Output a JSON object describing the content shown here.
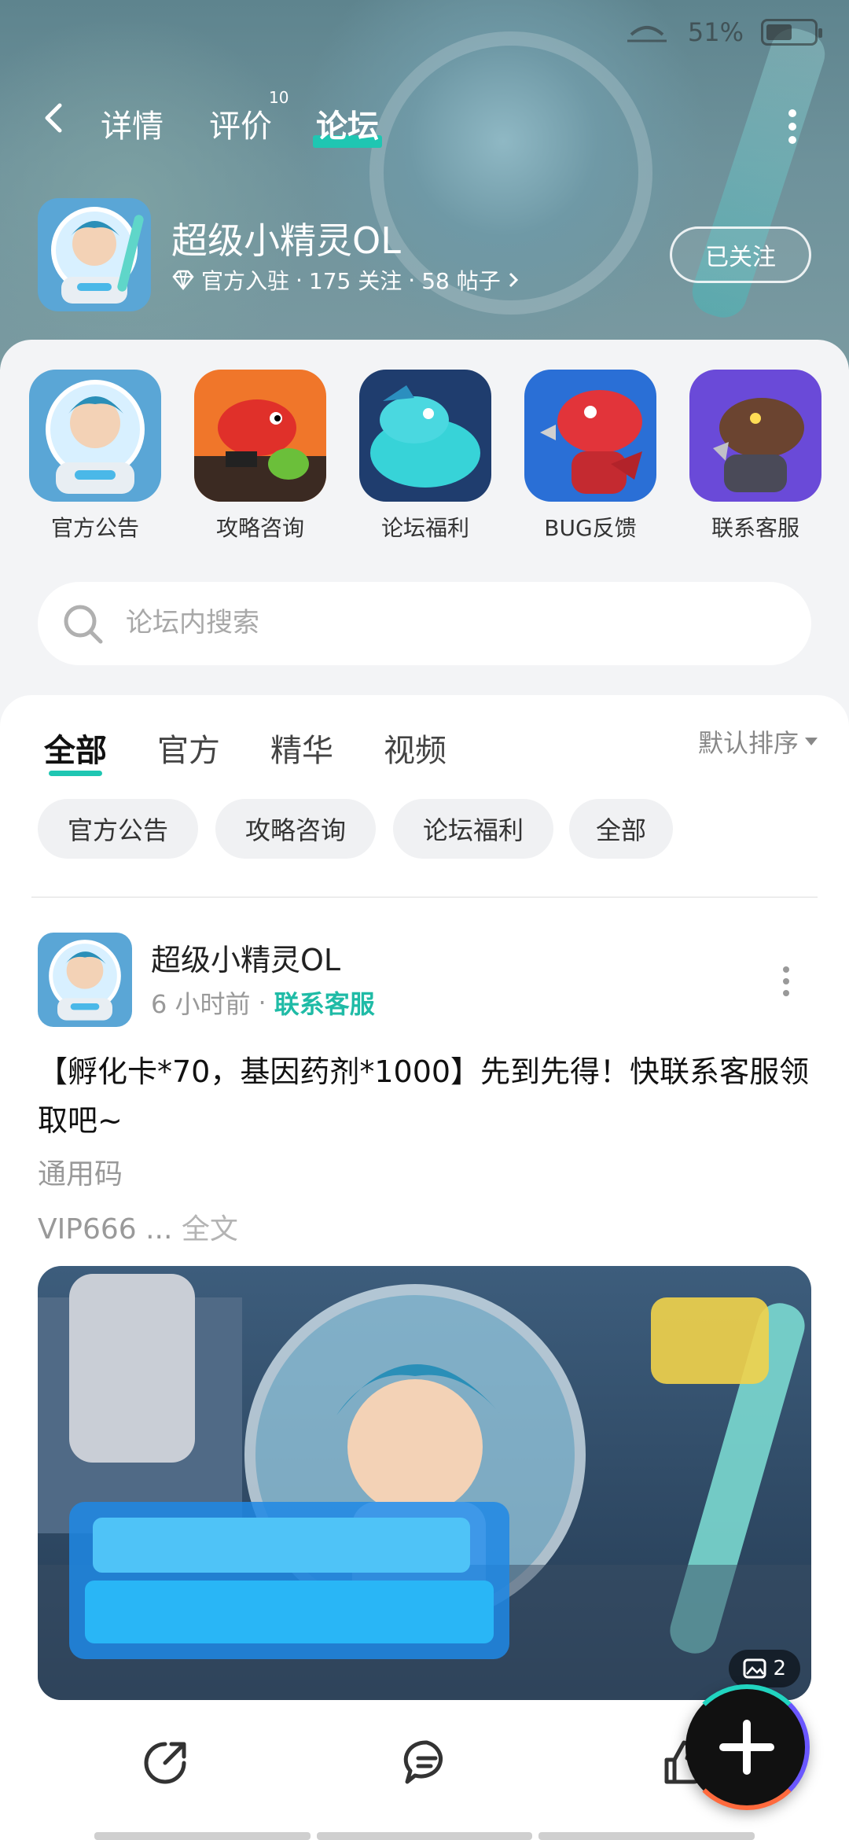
{
  "status_bar": {
    "battery": "51%"
  },
  "nav": {
    "tabs": [
      {
        "label": "详情"
      },
      {
        "label": "评价"
      },
      {
        "label": "论坛"
      }
    ],
    "review_badge": "10",
    "active_tab": "论坛"
  },
  "game": {
    "title": "超级小精灵OL",
    "official_label": "官方入驻",
    "followers": "175 关注",
    "posts": "58 帖子",
    "follow_button": "已关注"
  },
  "shortcuts": [
    {
      "label": "官方公告"
    },
    {
      "label": "攻略咨询"
    },
    {
      "label": "论坛福利"
    },
    {
      "label": "BUG反馈"
    },
    {
      "label": "联系客服"
    }
  ],
  "search": {
    "placeholder": "论坛内搜索"
  },
  "feed": {
    "tabs": [
      {
        "label": "全部"
      },
      {
        "label": "官方"
      },
      {
        "label": "精华"
      },
      {
        "label": "视频"
      }
    ],
    "sort_label": "默认排序",
    "chips": [
      {
        "label": "官方公告"
      },
      {
        "label": "攻略咨询"
      },
      {
        "label": "论坛福利"
      },
      {
        "label": "全部"
      }
    ]
  },
  "post": {
    "author": "超级小精灵OL",
    "time": "6 小时前",
    "separator": "·",
    "tag": "联系客服",
    "text": "【孵化卡*70，基因药剂*1000】先到先得！快联系客服领取吧~",
    "sub1": "通用码",
    "sub2": "VIP666 ...",
    "full_link": "全文",
    "image_count": "2"
  },
  "colors": {
    "accent": "#1fc6b2",
    "header_bg": "#6e929b",
    "sheet_bg": "#f3f4f6"
  }
}
